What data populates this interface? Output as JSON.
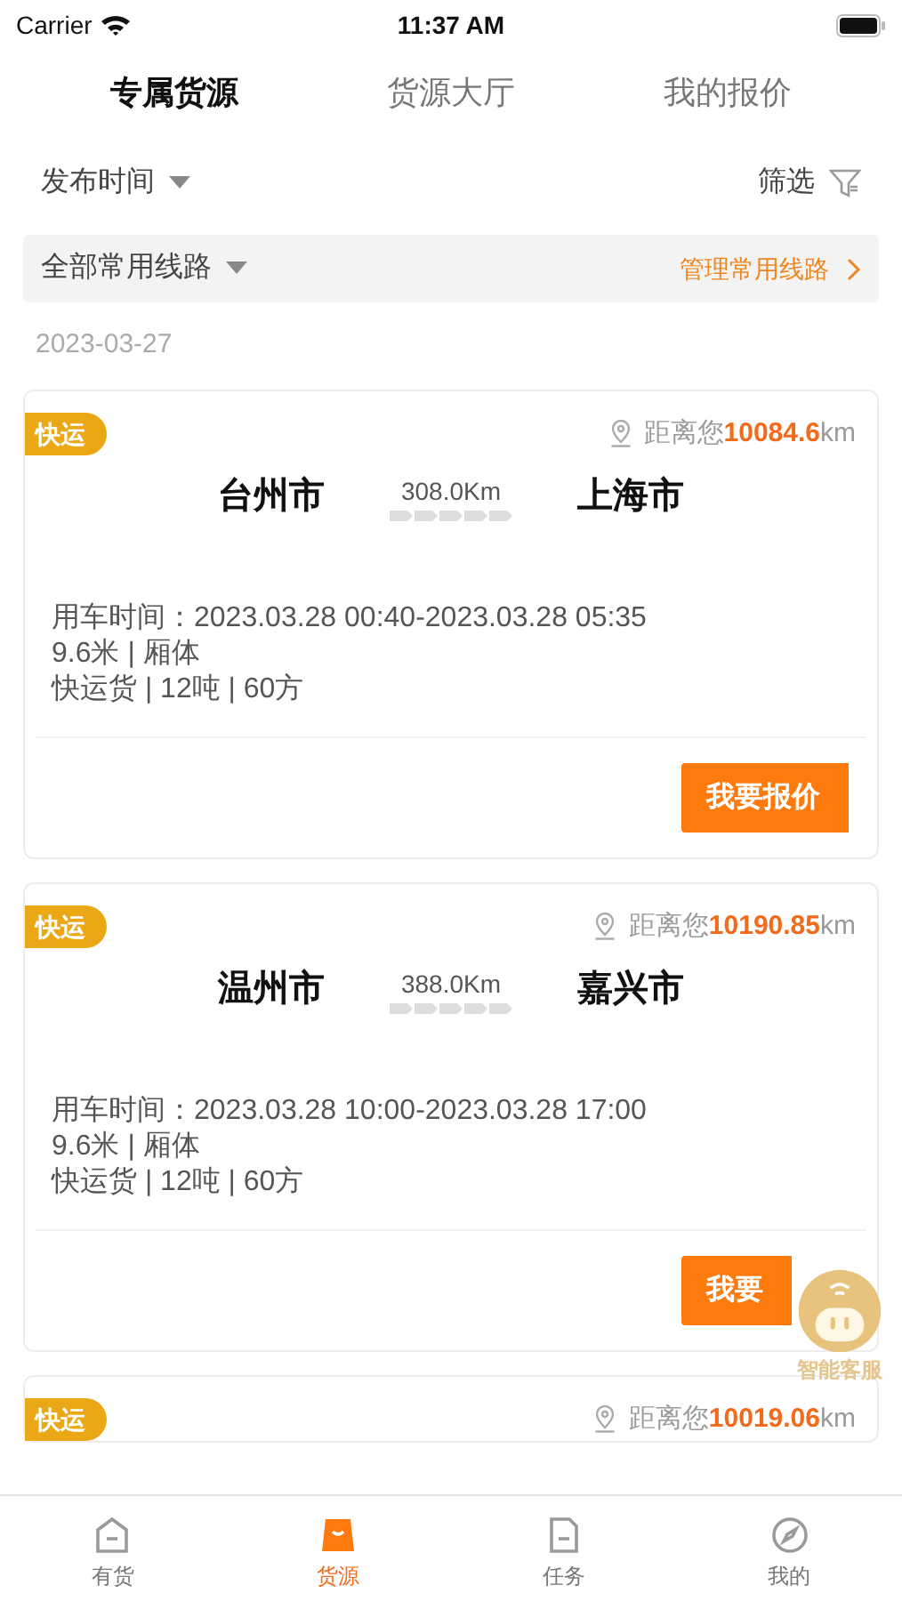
{
  "status_bar": {
    "carrier": "Carrier",
    "time": "11:37 AM"
  },
  "tabs": [
    {
      "label": "专属货源",
      "selected": true
    },
    {
      "label": "货源大厅",
      "selected": false
    },
    {
      "label": "我的报价",
      "selected": false
    }
  ],
  "filter_bar": {
    "sort": "发布时间",
    "filter": "筛选"
  },
  "route_bar": {
    "routes": "全部常用线路",
    "manage": "管理常用线路"
  },
  "date": "2023-03-27",
  "cards": [
    {
      "tag": "快运",
      "distance_prefix": "距离您",
      "distance_value": "10084.6",
      "distance_unit": "km",
      "from": "台州市",
      "route_length": "308.0Km",
      "to": "上海市",
      "time": "用车时间：2023.03.28 00:40-2023.03.28 05:35",
      "vehicle": "9.6米 | 厢体",
      "cargo": "快运货 | 12吨 | 60方",
      "button": "我要报价"
    },
    {
      "tag": "快运",
      "distance_prefix": "距离您",
      "distance_value": "10190.85",
      "distance_unit": "km",
      "from": "温州市",
      "route_length": "388.0Km",
      "to": "嘉兴市",
      "time": "用车时间：2023.03.28 10:00-2023.03.28 17:00",
      "vehicle": "9.6米 | 厢体",
      "cargo": "快运货 | 12吨 | 60方",
      "button": "我要"
    },
    {
      "tag": "快运",
      "distance_prefix": "距离您",
      "distance_value": "10019.06",
      "distance_unit": "km"
    }
  ],
  "assistant": {
    "label": "智能客服"
  },
  "bottom_nav": [
    {
      "label": "有货",
      "kind": "house",
      "selected": false
    },
    {
      "label": "货源",
      "kind": "bag",
      "selected": true
    },
    {
      "label": "任务",
      "kind": "doc",
      "selected": false
    },
    {
      "label": "我的",
      "kind": "compass",
      "selected": false
    }
  ]
}
